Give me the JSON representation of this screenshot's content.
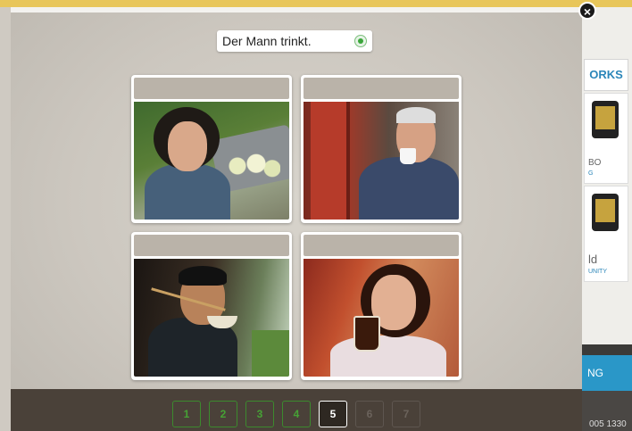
{
  "background": {
    "works_label": "ORKS",
    "card1_caption": "BO",
    "card1_caption2": "G",
    "card2_caption": "ld",
    "card2_caption2": "UNITY",
    "blue_label": "NG",
    "bottom_text": "005 1330"
  },
  "modal": {
    "close_symbol": "×",
    "prompt": {
      "text": "Der Mann trinkt.",
      "icon": "audio-play-icon"
    },
    "tiles": [
      {
        "name": "woman-eating-apple"
      },
      {
        "name": "old-man-drinking-coffee"
      },
      {
        "name": "man-eating-with-chopsticks"
      },
      {
        "name": "woman-drinking-coffee"
      }
    ],
    "pager": {
      "pages": [
        "1",
        "2",
        "3",
        "4",
        "5",
        "6",
        "7"
      ],
      "completed": [
        "1",
        "2",
        "3",
        "4"
      ],
      "current": "5",
      "upcoming": [
        "6",
        "7"
      ]
    }
  },
  "colors": {
    "accent_green": "#46a235",
    "pager_bg": "#4a4139",
    "label_box": "#bab3a9"
  }
}
